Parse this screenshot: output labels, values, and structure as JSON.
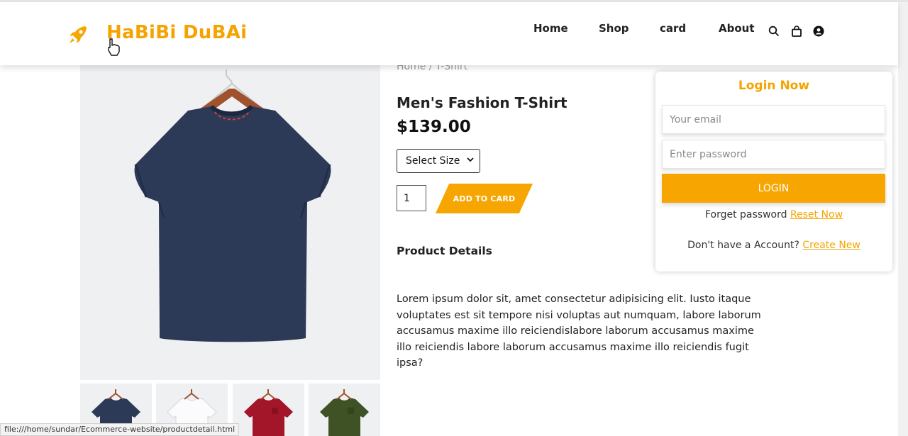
{
  "brand": {
    "name": "HaBiBi DuBAi",
    "color": "#f5a300",
    "icon": "rocket-icon"
  },
  "nav": {
    "items": [
      "Home",
      "Shop",
      "card",
      "About"
    ],
    "icons": [
      "search-icon",
      "shopping-bag-icon",
      "user-circle-icon"
    ]
  },
  "breadcrumb": "Home / T-Shirt",
  "product": {
    "title": "Men's Fashion T-Shirt",
    "price": "$139.00",
    "size_select": "Select Size",
    "quantity": "1",
    "add_button": "ADD TO CARD",
    "details_heading": "Product Details",
    "description": "Lorem ipsum dolor sit, amet consectetur adipisicing elit. Iusto itaque voluptates est sit tempore nisi voluptas aut numquam, labore laborum accusamus maxime illo reiciendislabore laborum accusamus maxime illo reiciendis labore laborum accusamus maxime illo reiciendis fugit ipsa?",
    "main_color": "#2c3a57",
    "thumbnail_colors": [
      "#2c3a57",
      "#f2f3f5",
      "#a3162a",
      "#3f5226"
    ]
  },
  "login": {
    "title": "Login Now",
    "email_placeholder": "Your email",
    "password_placeholder": "Enter password",
    "button": "LOGIN",
    "forget_text": "Forget password",
    "reset_link": "Reset Now",
    "account_text": "Don't have a Account?",
    "create_link": "Create New"
  },
  "status_bar": "file:///home/sundar/Ecommerce-website/productdetail.html",
  "accent_color": "#f7a500"
}
